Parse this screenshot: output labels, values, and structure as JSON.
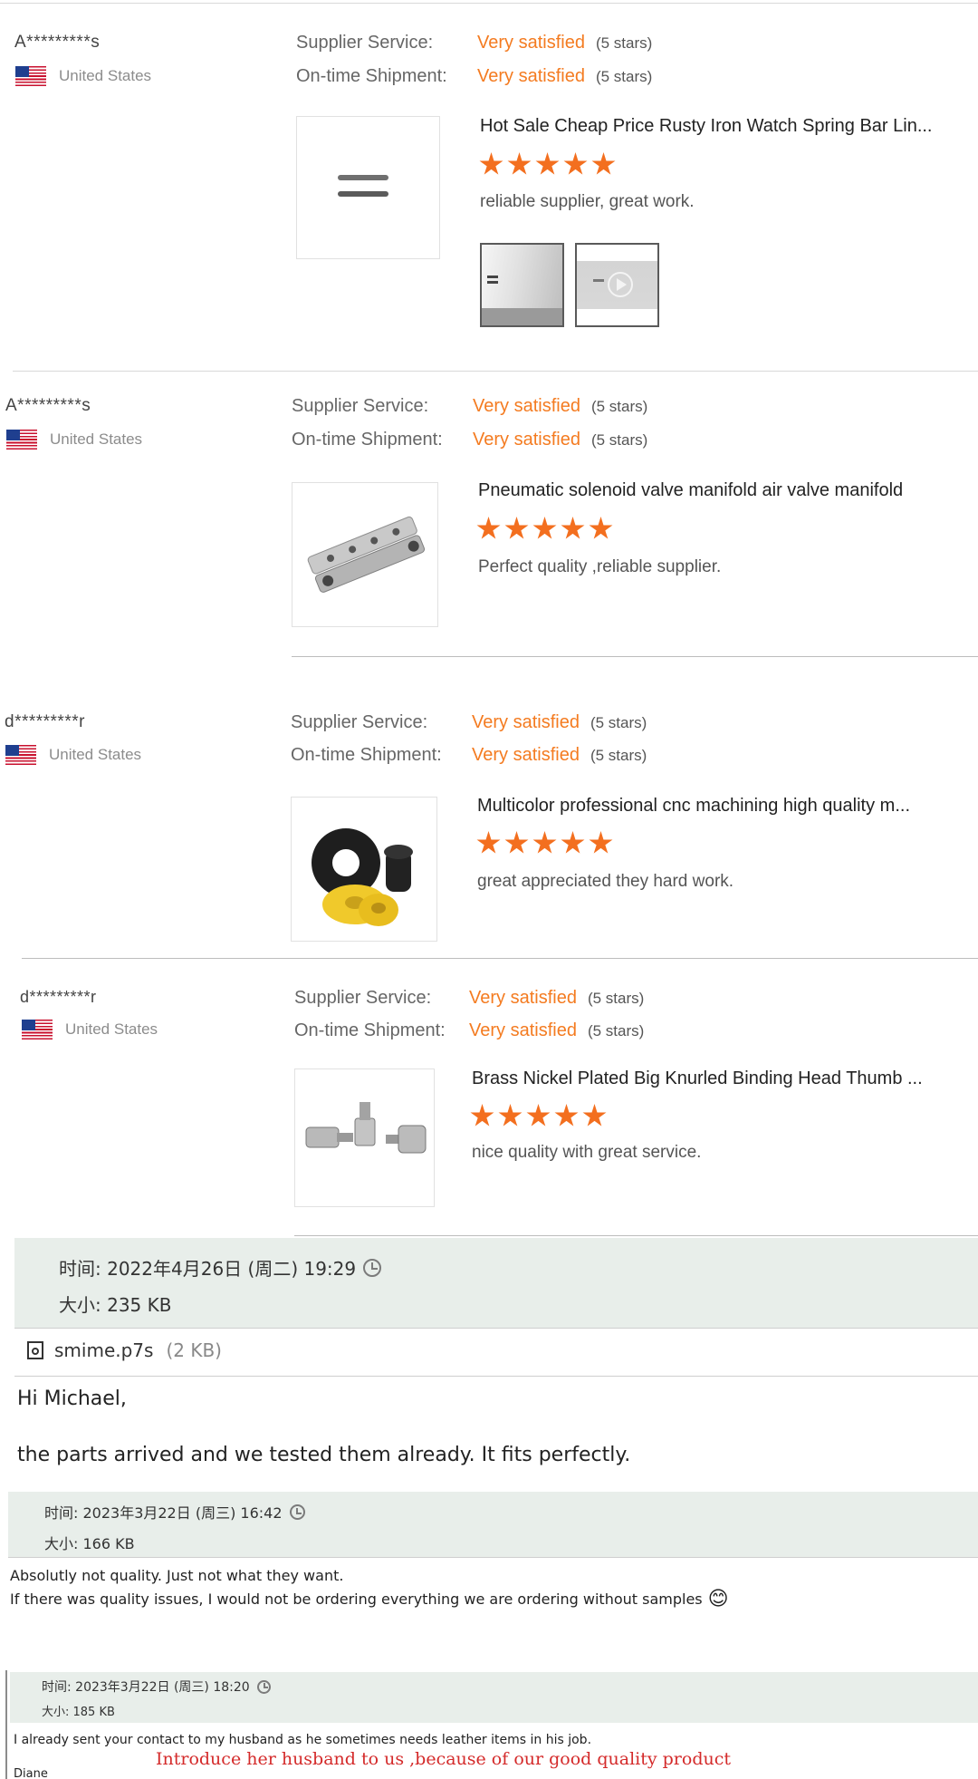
{
  "reviews": [
    {
      "buyer": "A*********s",
      "country": "United States",
      "supplier_label": "Supplier Service:",
      "supplier_value": "Very satisfied",
      "supplier_stars": "(5 stars)",
      "shipment_label": "On-time Shipment:",
      "shipment_value": "Very satisfied",
      "shipment_stars": "(5 stars)",
      "product": "Hot Sale Cheap Price Rusty Iron Watch Spring Bar Lin...",
      "rating": 5,
      "comment": "reliable supplier, great work."
    },
    {
      "buyer": "A*********s",
      "country": "United States",
      "supplier_label": "Supplier Service:",
      "supplier_value": "Very satisfied",
      "supplier_stars": "(5 stars)",
      "shipment_label": "On-time Shipment:",
      "shipment_value": "Very satisfied",
      "shipment_stars": "(5 stars)",
      "product": "Pneumatic solenoid valve manifold air valve manifold",
      "rating": 5,
      "comment": "Perfect quality ,reliable supplier."
    },
    {
      "buyer": "d*********r",
      "country": "United States",
      "supplier_label": "Supplier Service:",
      "supplier_value": "Very satisfied",
      "supplier_stars": "(5 stars)",
      "shipment_label": "On-time Shipment:",
      "shipment_value": "Very satisfied",
      "shipment_stars": "(5 stars)",
      "product": "Multicolor professional cnc machining high quality m...",
      "rating": 5,
      "comment": "great appreciated they hard work."
    },
    {
      "buyer": "d*********r",
      "country": "United States",
      "supplier_label": "Supplier Service:",
      "supplier_value": "Very satisfied",
      "supplier_stars": "(5 stars)",
      "shipment_label": "On-time Shipment:",
      "shipment_value": "Very satisfied",
      "shipment_stars": "(5 stars)",
      "product": "Brass Nickel Plated Big Knurled Binding Head Thumb ...",
      "rating": 5,
      "comment": "nice quality with great service."
    }
  ],
  "email1": {
    "time": "时间: 2022年4月26日 (周二) 19:29",
    "size": "大小: 235 KB",
    "attachment_name": "smime.p7s",
    "attachment_size": "(2 KB)",
    "greeting": "Hi Michael,",
    "body": "the parts arrived and we tested them already. It fits perfectly."
  },
  "email2": {
    "time": "时间: 2023年3月22日 (周三) 16:42",
    "size": "大小: 166 KB",
    "line1": "Absolutly not quality. Just not what they want.",
    "line2": "If there was quality issues, I would not be ordering everything we are ordering without samples",
    "emoji": "😊"
  },
  "email3": {
    "time": "时间: 2023年3月22日 (周三) 18:20",
    "size": "大小: 185 KB",
    "line1": "I already sent your contact to my husband as he sometimes needs leather items in his job.",
    "annotation": "Introduce her husband to us ,because of our good quality product",
    "signature": "Diane"
  },
  "colors": {
    "accent": "#f47b20",
    "star": "#f36f1f",
    "annotation": "#d42a2a"
  }
}
